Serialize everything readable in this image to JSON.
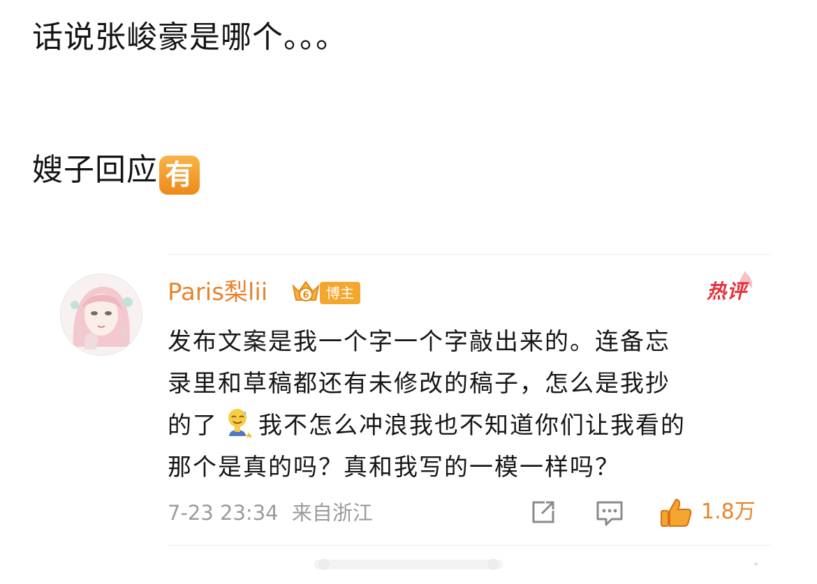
{
  "post": {
    "line1": "话说张峻豪是哪个。。。",
    "line2": "嫂子回应",
    "line2_emoji_text": "有"
  },
  "comment": {
    "username": "Paris梨lii",
    "level_badge_text": "6",
    "blogger_badge": "博主",
    "hot_tag": "热评",
    "lines": [
      "发布文案是我一个字一个字敲出来的。连备忘",
      "录里和草稿都还有未修改的稿子，怎么是我抄",
      "的了",
      "我不怎么冲浪我也不知道你们让我看的",
      "那个是真的吗？真和我写的一模一样吗？"
    ],
    "emoji_name": "sweat-smile-emoji",
    "timestamp": "7-23 23:34",
    "location": "来自浙江",
    "like_count": "1.8万"
  },
  "colors": {
    "username": "#e8832c",
    "like": "#f08a1e",
    "hot": "#e3313a",
    "badge": "#f4a72f",
    "meta": "#9b9b9b"
  },
  "icons": [
    "share-icon",
    "comment-icon",
    "thumbs-up-icon",
    "crown-icon",
    "flame-icon"
  ]
}
